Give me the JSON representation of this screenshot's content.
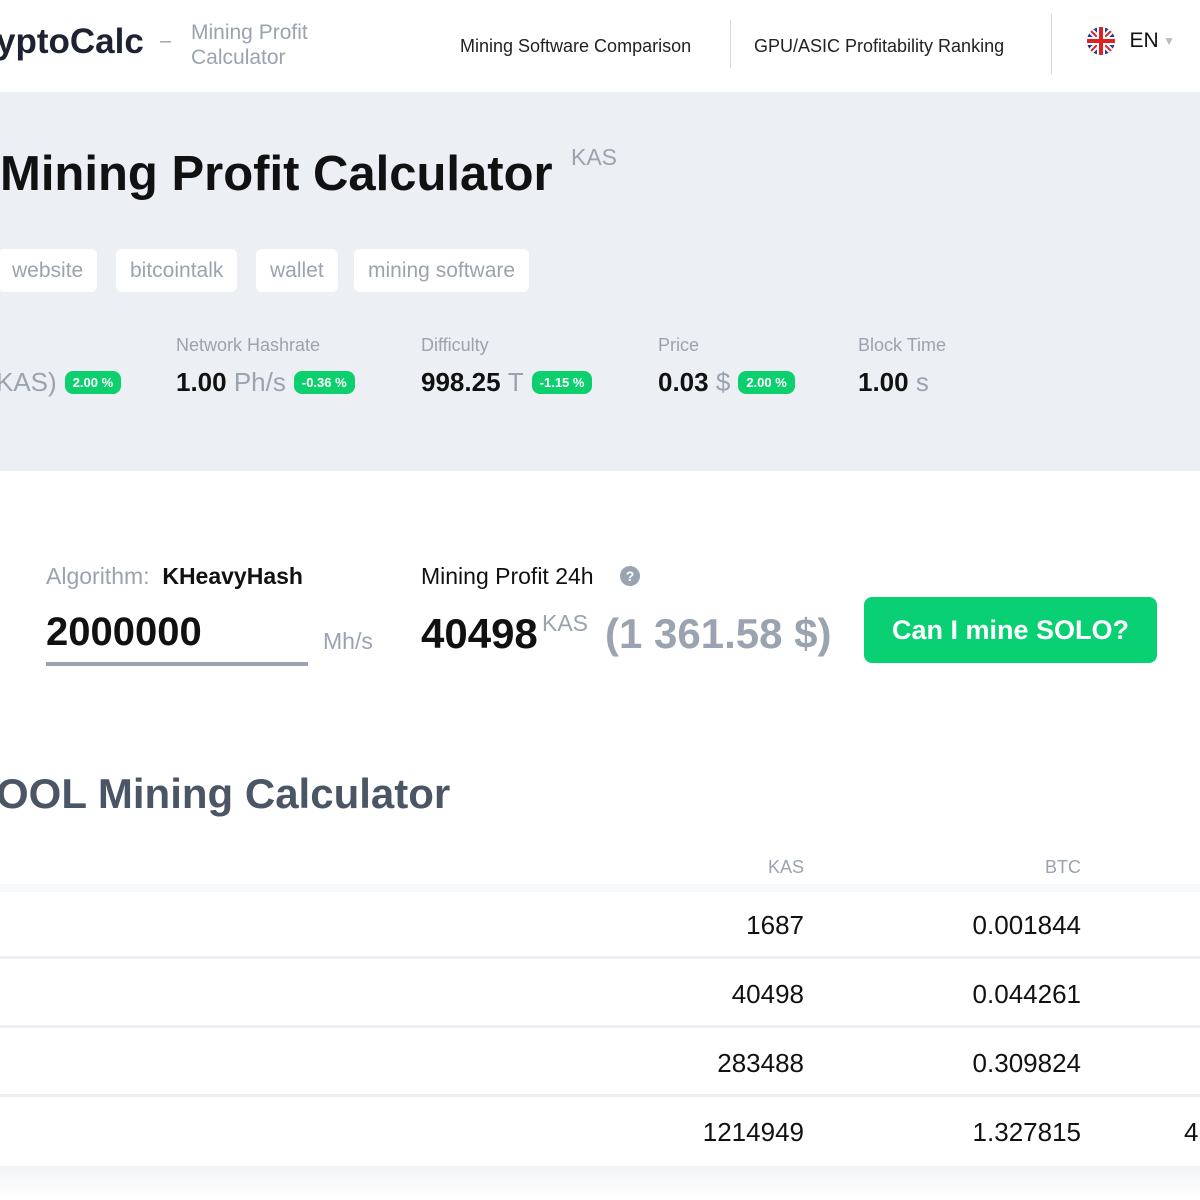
{
  "header": {
    "logo": "yptoCalc",
    "dash": "–",
    "subtitle": "Mining Profit Calculator",
    "nav": [
      "Mining Software Comparison",
      "GPU/ASIC Profitability Ranking"
    ],
    "lang": "EN"
  },
  "hero": {
    "title": "Mining Profit Calculator",
    "coin": "KAS",
    "tags": [
      "website",
      "bitcointalk",
      "wallet",
      "mining software"
    ],
    "stats": [
      {
        "label": "",
        "value": "",
        "unit": "KAS)",
        "change": "2.00 %"
      },
      {
        "label": "Network Hashrate",
        "value": "1.00",
        "unit": "Ph/s",
        "change": "-0.36 %"
      },
      {
        "label": "Difficulty",
        "value": "998.25",
        "unit": "T",
        "change": "-1.15 %"
      },
      {
        "label": "Price",
        "value": "0.03",
        "unit": "$",
        "change": "2.00 %"
      },
      {
        "label": "Block Time",
        "value": "1.00",
        "unit": "s",
        "change": ""
      }
    ]
  },
  "calc": {
    "algo_label": "Algorithm:",
    "algo": "KHeavyHash",
    "hashrate": "2000000",
    "hash_unit": "Mh/s",
    "profit_label": "Mining Profit 24h",
    "profit": "40498",
    "profit_coin": "KAS",
    "profit_usd": "(1 361.58 $)",
    "solo_button": "Can I mine SOLO?"
  },
  "pool": {
    "title": "OOL Mining Calculator",
    "columns": [
      "KAS",
      "BTC"
    ],
    "rows": [
      [
        "1687",
        "0.001844",
        ""
      ],
      [
        "40498",
        "0.044261",
        ""
      ],
      [
        "283488",
        "0.309824",
        ""
      ],
      [
        "1214949",
        "1.327815",
        "4"
      ]
    ]
  },
  "colors": {
    "accent": "#08d073",
    "hero_bg": "#eceff3"
  }
}
